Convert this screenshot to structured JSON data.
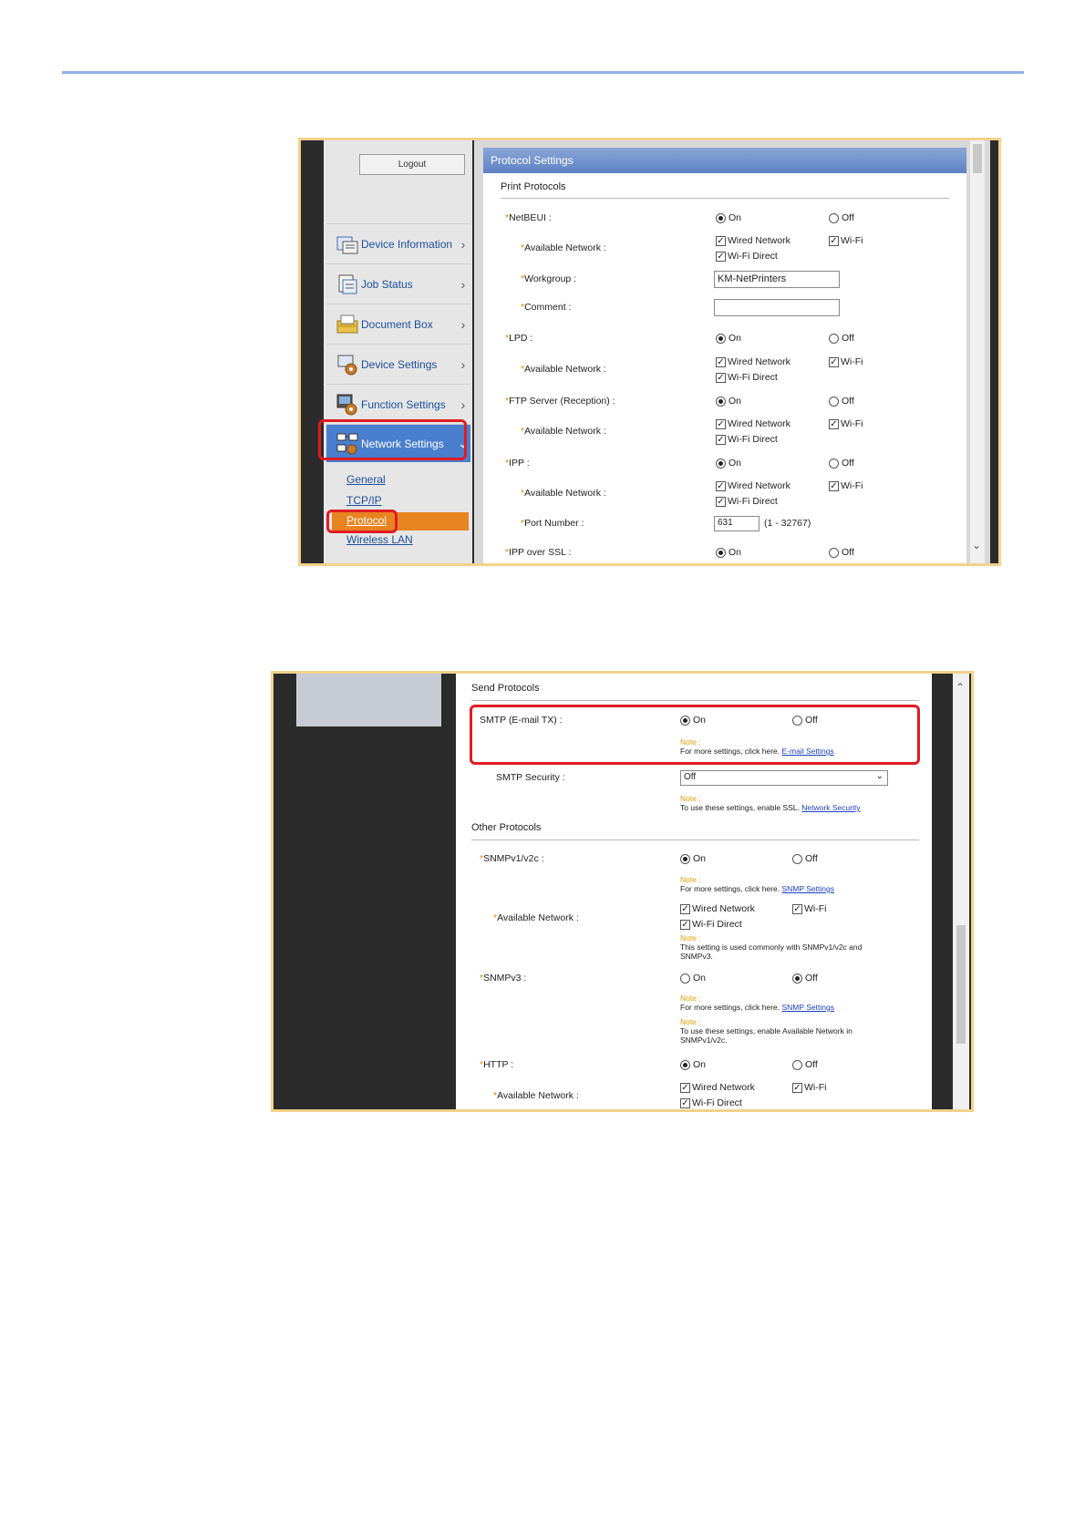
{
  "shot1": {
    "logout": "Logout",
    "nav": [
      {
        "label": "Device Information",
        "icon": "device-info-icon"
      },
      {
        "label": "Job Status",
        "icon": "job-status-icon"
      },
      {
        "label": "Document Box",
        "icon": "document-box-icon"
      },
      {
        "label": "Device Settings",
        "icon": "device-settings-icon"
      },
      {
        "label": "Function Settings",
        "icon": "function-settings-icon"
      },
      {
        "label": "Network Settings",
        "icon": "network-settings-icon"
      }
    ],
    "sub": [
      "General",
      "TCP/IP",
      "Protocol",
      "Wireless LAN"
    ],
    "header": "Protocol Settings",
    "section": "Print Protocols",
    "on": "On",
    "off": "Off",
    "wired": "Wired Network",
    "wifi": "Wi-Fi",
    "wifi_direct": "Wi-Fi Direct",
    "avail": "Available Network :",
    "netbeui": "NetBEUI :",
    "workgroup": "Workgroup :",
    "workgroup_value": "KM-NetPrinters",
    "comment": "Comment :",
    "lpd": "LPD :",
    "ftp": "FTP Server (Reception) :",
    "ipp": "IPP :",
    "port": "Port Number :",
    "port_value": "631",
    "port_range": "(1 - 32767)",
    "ipp_ssl": "IPP over SSL :"
  },
  "shot2": {
    "send_section": "Send Protocols",
    "smtp": "SMTP (E-mail TX) :",
    "on": "On",
    "off": "Off",
    "note": "Note :",
    "smtp_note": "For more settings, click here.",
    "smtp_link": "E-mail Settings",
    "smtp_security": "SMTP Security :",
    "smtp_security_value": "Off",
    "ssl_note": "To use these settings, enable SSL.",
    "ssl_link": "Network Security",
    "other_section": "Other Protocols",
    "snmpv1": "SNMPv1/v2c :",
    "snmp_note": "For more settings, click here.",
    "snmp_link": "SNMP Settings",
    "avail": "Available Network :",
    "wired": "Wired Network",
    "wifi": "Wi-Fi",
    "wifi_direct": "Wi-Fi Direct",
    "common_note": "This setting is used commonly with SNMPv1/v2c and SNMPv3.",
    "snmpv3": "SNMPv3 :",
    "snmpv3_note2": "To use these settings, enable Available Network in SNMPv1/v2c.",
    "http": "HTTP :"
  }
}
